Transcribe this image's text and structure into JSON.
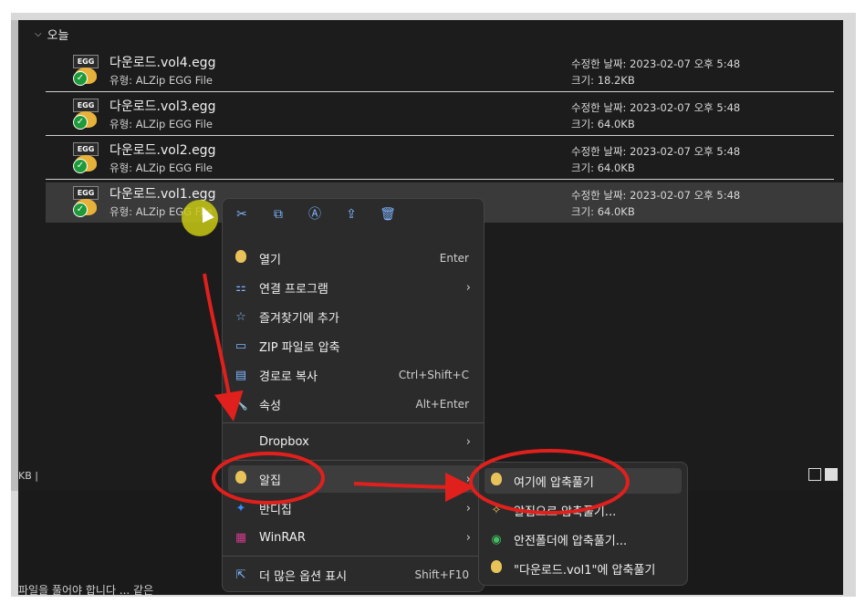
{
  "group_header": "오늘",
  "files": [
    {
      "name": "다운로드.vol4.egg",
      "type": "유형: ALZip EGG File",
      "date": "수정한 날짜: 2023-02-07 오후 5:48",
      "size": "크기: 18.2KB"
    },
    {
      "name": "다운로드.vol3.egg",
      "type": "유형: ALZip EGG File",
      "date": "수정한 날짜: 2023-02-07 오후 5:48",
      "size": "크기: 64.0KB"
    },
    {
      "name": "다운로드.vol2.egg",
      "type": "유형: ALZip EGG File",
      "date": "수정한 날짜: 2023-02-07 오후 5:48",
      "size": "크기: 64.0KB"
    },
    {
      "name": "다운로드.vol1.egg",
      "type": "유형: ALZip EGG File",
      "date": "수정한 날짜: 2023-02-07 오후 5:48",
      "size": "크기: 64.0KB"
    }
  ],
  "file_badge": "EGG",
  "status_left": "KB",
  "below_text": "파일을 풀어야 합니다 ... 같은",
  "context_menu": {
    "quick_actions": [
      "cut-icon",
      "copy-icon",
      "rename-icon",
      "share-icon",
      "delete-icon"
    ],
    "items": [
      {
        "label": "열기",
        "shortcut": "Enter",
        "icon": "egg-icon"
      },
      {
        "label": "연결 프로그램",
        "icon": "open-with-icon",
        "arrow": "›"
      },
      {
        "label": "즐겨찾기에 추가",
        "icon": "star-icon"
      },
      {
        "label": "ZIP 파일로 압축",
        "icon": "zip-folder-icon"
      },
      {
        "label": "경로로 복사",
        "shortcut": "Ctrl+Shift+C",
        "icon": "copy-path-icon"
      },
      {
        "label": "속성",
        "shortcut": "Alt+Enter",
        "icon": "wrench-icon"
      },
      {
        "label": "Dropbox",
        "arrow": "›"
      },
      {
        "label": "알집",
        "icon": "egg-icon",
        "arrow": "›"
      },
      {
        "label": "반디집",
        "icon": "bandizip-icon",
        "arrow": "›"
      },
      {
        "label": "WinRAR",
        "icon": "winrar-icon",
        "arrow": "›"
      },
      {
        "label": "더 많은 옵션 표시",
        "shortcut": "Shift+F10",
        "icon": "more-options-icon"
      }
    ]
  },
  "submenu": {
    "items": [
      {
        "label": "여기에 압축풀기",
        "icon": "egg-icon"
      },
      {
        "label": "알집으로 압축풀기...",
        "icon": "alzip-extract-icon"
      },
      {
        "label": "안전폴더에 압축풀기...",
        "icon": "safe-folder-icon"
      },
      {
        "label": "\"다운로드.vol1\"에 압축풀기",
        "icon": "egg-icon"
      }
    ]
  },
  "colors": {
    "annotation_red": "#e0201c",
    "cursor_halo": "#c8c814",
    "accent_blue": "#7fb6ff"
  }
}
